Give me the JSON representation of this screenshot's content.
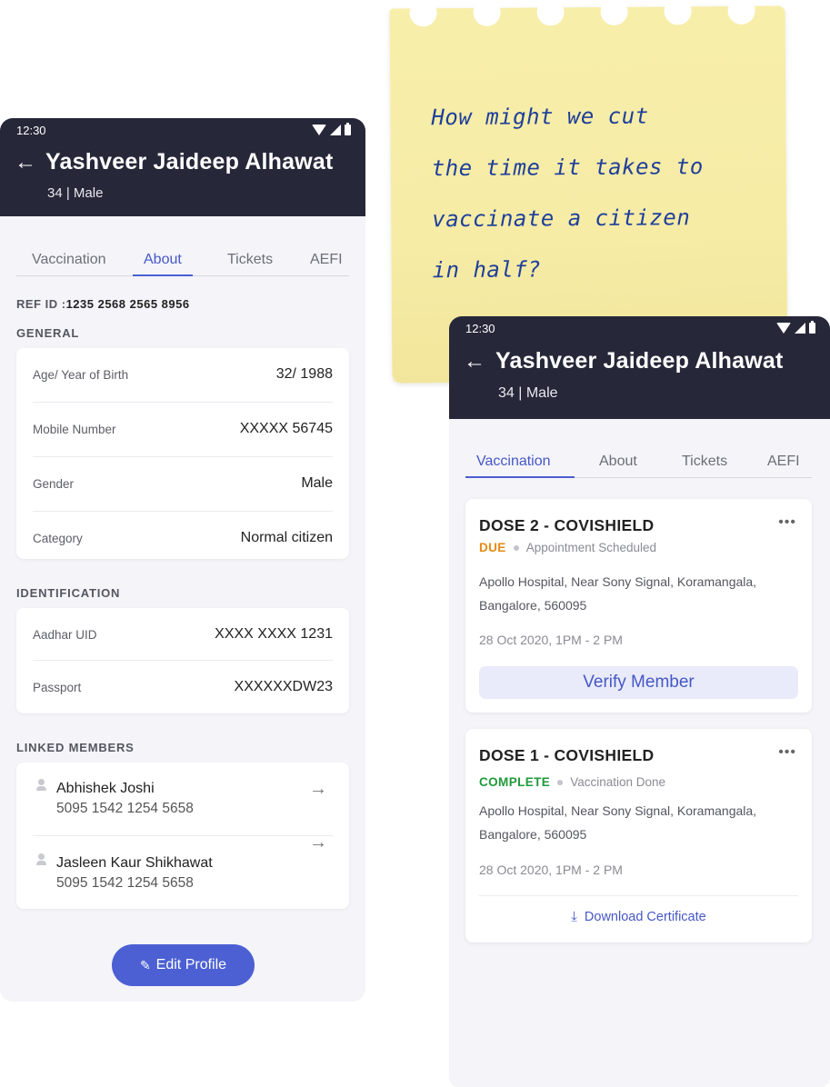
{
  "sticky_note": {
    "lines": [
      "How might we cut",
      "the time it takes to",
      "vaccinate a citizen",
      "in half?"
    ]
  },
  "left_phone": {
    "status_time": "12:30",
    "name": "Yashveer Jaideep Alhawat",
    "subinfo": "34 | Male",
    "tabs": [
      "Vaccination",
      "About",
      "Tickets",
      "AEFI"
    ],
    "active_tab": "About",
    "ref_id_label": "REF ID :",
    "ref_id_value": "1235 2568 2565 8956",
    "general_label": "GENERAL",
    "general_rows": [
      {
        "key": "Age/ Year of Birth",
        "value": "32/ 1988"
      },
      {
        "key": "Mobile Number",
        "value": "XXXXX 56745"
      },
      {
        "key": "Gender",
        "value": "Male"
      },
      {
        "key": "Category",
        "value": "Normal citizen"
      }
    ],
    "identification_label": "IDENTIFICATION",
    "identification_rows": [
      {
        "key": "Aadhar UID",
        "value": "XXXX XXXX 1231"
      },
      {
        "key": "Passport",
        "value": "XXXXXXDW23"
      }
    ],
    "linked_label": "LINKED MEMBERS",
    "linked_members": [
      {
        "name": "Abhishek Joshi",
        "id": "5095 1542 1254 5658"
      },
      {
        "name": "Jasleen Kaur Shikhawat",
        "id": "5095 1542 1254 5658"
      }
    ],
    "edit_button": "Edit Profile"
  },
  "right_phone": {
    "status_time": "12:30",
    "name": "Yashveer Jaideep Alhawat",
    "subinfo": "34 | Male",
    "tabs": [
      "Vaccination",
      "About",
      "Tickets",
      "AEFI"
    ],
    "active_tab": "Vaccination",
    "doses": [
      {
        "title": "DOSE 2 - COVISHIELD",
        "status": "DUE",
        "status_color": "#e58a12",
        "status_note": "Appointment Scheduled",
        "address_line1": "Apollo Hospital, Near Sony Signal, Koramangala,",
        "address_line2": "Bangalore, 560095",
        "time": "28 Oct 2020, 1PM - 2 PM",
        "action": "Verify Member"
      },
      {
        "title": "DOSE 1 - COVISHIELD",
        "status": "COMPLETE",
        "status_color": "#1f9a3a",
        "status_note": "Vaccination Done",
        "address_line1": "Apollo Hospital, Near Sony Signal, Koramangala,",
        "address_line2": "Bangalore, 560095",
        "time": "28 Oct 2020, 1PM - 2 PM",
        "action": "Download Certificate"
      }
    ]
  },
  "colors": {
    "appbar": "#262839",
    "accent": "#4c60d3",
    "note": "#f6eca6"
  }
}
